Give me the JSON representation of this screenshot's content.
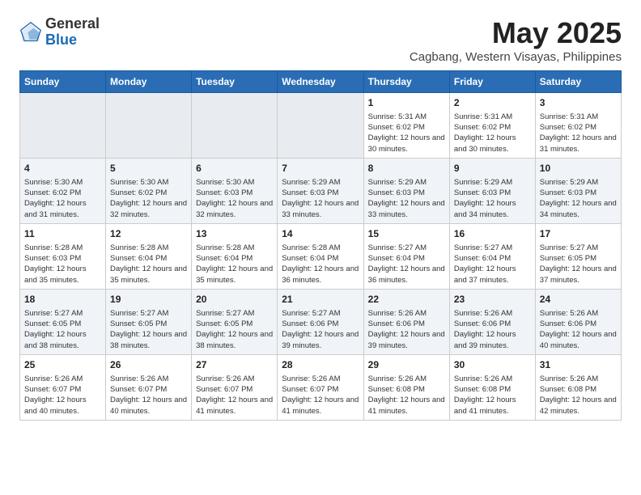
{
  "logo": {
    "general": "General",
    "blue": "Blue"
  },
  "title": "May 2025",
  "subtitle": "Cagbang, Western Visayas, Philippines",
  "days_header": [
    "Sunday",
    "Monday",
    "Tuesday",
    "Wednesday",
    "Thursday",
    "Friday",
    "Saturday"
  ],
  "weeks": [
    [
      {
        "day": "",
        "sunrise": "",
        "sunset": "",
        "daylight": ""
      },
      {
        "day": "",
        "sunrise": "",
        "sunset": "",
        "daylight": ""
      },
      {
        "day": "",
        "sunrise": "",
        "sunset": "",
        "daylight": ""
      },
      {
        "day": "",
        "sunrise": "",
        "sunset": "",
        "daylight": ""
      },
      {
        "day": "1",
        "sunrise": "Sunrise: 5:31 AM",
        "sunset": "Sunset: 6:02 PM",
        "daylight": "Daylight: 12 hours and 30 minutes."
      },
      {
        "day": "2",
        "sunrise": "Sunrise: 5:31 AM",
        "sunset": "Sunset: 6:02 PM",
        "daylight": "Daylight: 12 hours and 30 minutes."
      },
      {
        "day": "3",
        "sunrise": "Sunrise: 5:31 AM",
        "sunset": "Sunset: 6:02 PM",
        "daylight": "Daylight: 12 hours and 31 minutes."
      }
    ],
    [
      {
        "day": "4",
        "sunrise": "Sunrise: 5:30 AM",
        "sunset": "Sunset: 6:02 PM",
        "daylight": "Daylight: 12 hours and 31 minutes."
      },
      {
        "day": "5",
        "sunrise": "Sunrise: 5:30 AM",
        "sunset": "Sunset: 6:02 PM",
        "daylight": "Daylight: 12 hours and 32 minutes."
      },
      {
        "day": "6",
        "sunrise": "Sunrise: 5:30 AM",
        "sunset": "Sunset: 6:03 PM",
        "daylight": "Daylight: 12 hours and 32 minutes."
      },
      {
        "day": "7",
        "sunrise": "Sunrise: 5:29 AM",
        "sunset": "Sunset: 6:03 PM",
        "daylight": "Daylight: 12 hours and 33 minutes."
      },
      {
        "day": "8",
        "sunrise": "Sunrise: 5:29 AM",
        "sunset": "Sunset: 6:03 PM",
        "daylight": "Daylight: 12 hours and 33 minutes."
      },
      {
        "day": "9",
        "sunrise": "Sunrise: 5:29 AM",
        "sunset": "Sunset: 6:03 PM",
        "daylight": "Daylight: 12 hours and 34 minutes."
      },
      {
        "day": "10",
        "sunrise": "Sunrise: 5:29 AM",
        "sunset": "Sunset: 6:03 PM",
        "daylight": "Daylight: 12 hours and 34 minutes."
      }
    ],
    [
      {
        "day": "11",
        "sunrise": "Sunrise: 5:28 AM",
        "sunset": "Sunset: 6:03 PM",
        "daylight": "Daylight: 12 hours and 35 minutes."
      },
      {
        "day": "12",
        "sunrise": "Sunrise: 5:28 AM",
        "sunset": "Sunset: 6:04 PM",
        "daylight": "Daylight: 12 hours and 35 minutes."
      },
      {
        "day": "13",
        "sunrise": "Sunrise: 5:28 AM",
        "sunset": "Sunset: 6:04 PM",
        "daylight": "Daylight: 12 hours and 35 minutes."
      },
      {
        "day": "14",
        "sunrise": "Sunrise: 5:28 AM",
        "sunset": "Sunset: 6:04 PM",
        "daylight": "Daylight: 12 hours and 36 minutes."
      },
      {
        "day": "15",
        "sunrise": "Sunrise: 5:27 AM",
        "sunset": "Sunset: 6:04 PM",
        "daylight": "Daylight: 12 hours and 36 minutes."
      },
      {
        "day": "16",
        "sunrise": "Sunrise: 5:27 AM",
        "sunset": "Sunset: 6:04 PM",
        "daylight": "Daylight: 12 hours and 37 minutes."
      },
      {
        "day": "17",
        "sunrise": "Sunrise: 5:27 AM",
        "sunset": "Sunset: 6:05 PM",
        "daylight": "Daylight: 12 hours and 37 minutes."
      }
    ],
    [
      {
        "day": "18",
        "sunrise": "Sunrise: 5:27 AM",
        "sunset": "Sunset: 6:05 PM",
        "daylight": "Daylight: 12 hours and 38 minutes."
      },
      {
        "day": "19",
        "sunrise": "Sunrise: 5:27 AM",
        "sunset": "Sunset: 6:05 PM",
        "daylight": "Daylight: 12 hours and 38 minutes."
      },
      {
        "day": "20",
        "sunrise": "Sunrise: 5:27 AM",
        "sunset": "Sunset: 6:05 PM",
        "daylight": "Daylight: 12 hours and 38 minutes."
      },
      {
        "day": "21",
        "sunrise": "Sunrise: 5:27 AM",
        "sunset": "Sunset: 6:06 PM",
        "daylight": "Daylight: 12 hours and 39 minutes."
      },
      {
        "day": "22",
        "sunrise": "Sunrise: 5:26 AM",
        "sunset": "Sunset: 6:06 PM",
        "daylight": "Daylight: 12 hours and 39 minutes."
      },
      {
        "day": "23",
        "sunrise": "Sunrise: 5:26 AM",
        "sunset": "Sunset: 6:06 PM",
        "daylight": "Daylight: 12 hours and 39 minutes."
      },
      {
        "day": "24",
        "sunrise": "Sunrise: 5:26 AM",
        "sunset": "Sunset: 6:06 PM",
        "daylight": "Daylight: 12 hours and 40 minutes."
      }
    ],
    [
      {
        "day": "25",
        "sunrise": "Sunrise: 5:26 AM",
        "sunset": "Sunset: 6:07 PM",
        "daylight": "Daylight: 12 hours and 40 minutes."
      },
      {
        "day": "26",
        "sunrise": "Sunrise: 5:26 AM",
        "sunset": "Sunset: 6:07 PM",
        "daylight": "Daylight: 12 hours and 40 minutes."
      },
      {
        "day": "27",
        "sunrise": "Sunrise: 5:26 AM",
        "sunset": "Sunset: 6:07 PM",
        "daylight": "Daylight: 12 hours and 41 minutes."
      },
      {
        "day": "28",
        "sunrise": "Sunrise: 5:26 AM",
        "sunset": "Sunset: 6:07 PM",
        "daylight": "Daylight: 12 hours and 41 minutes."
      },
      {
        "day": "29",
        "sunrise": "Sunrise: 5:26 AM",
        "sunset": "Sunset: 6:08 PM",
        "daylight": "Daylight: 12 hours and 41 minutes."
      },
      {
        "day": "30",
        "sunrise": "Sunrise: 5:26 AM",
        "sunset": "Sunset: 6:08 PM",
        "daylight": "Daylight: 12 hours and 41 minutes."
      },
      {
        "day": "31",
        "sunrise": "Sunrise: 5:26 AM",
        "sunset": "Sunset: 6:08 PM",
        "daylight": "Daylight: 12 hours and 42 minutes."
      }
    ]
  ]
}
